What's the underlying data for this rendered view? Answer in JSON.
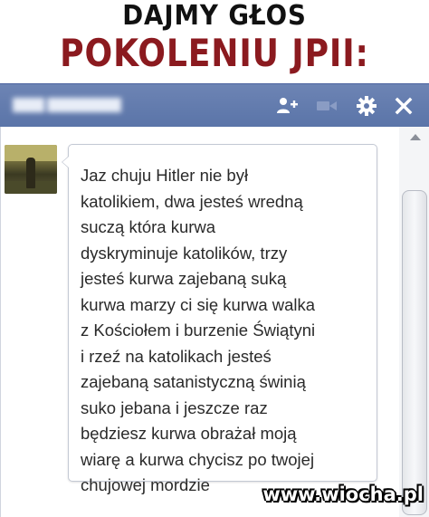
{
  "headline": {
    "line1": "DAJMY GŁOS",
    "line2": "POKOLENIU JPII:"
  },
  "colors": {
    "titlebar": "#6d84b4",
    "headline_red": "#8b1a1f",
    "headline_black": "#111111"
  },
  "chat": {
    "titlebar_icons": [
      "add-friend-icon",
      "video-call-icon",
      "gear-icon",
      "close-icon"
    ],
    "message_lines": [
      "Jaz chuju Hitler nie był",
      "katolikiem, dwa jesteś wredną",
      "suczą która kurwa",
      "dyskryminuje katolików, trzy",
      "jesteś kurwa zajebaną suką",
      "kurwa marzy ci się kurwa walka",
      "z Kościołem i burzenie Świątyni",
      "i rzeź na katolikach jesteś",
      "zajebaną satanistyczną świnią",
      "suko jebana i jeszcze raz",
      "będziesz kurwa obrażał moją",
      "wiarę a kurwa chycisz po twojej",
      "chujowej mordzie"
    ]
  },
  "watermark": "www.wiocha.pl"
}
